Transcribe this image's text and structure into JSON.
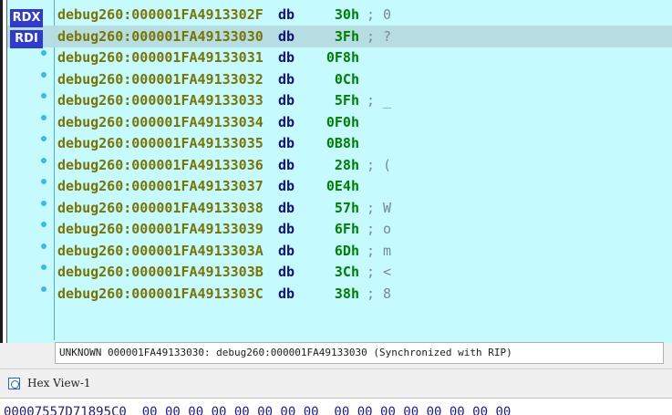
{
  "registers": [
    "RDX",
    "RDI"
  ],
  "listing": [
    {
      "addr": "debug260:000001FA4913302F",
      "mnem": "db",
      "oper": "30h",
      "cmt": "; 0"
    },
    {
      "addr": "debug260:000001FA49133030",
      "mnem": "db",
      "oper": "3Fh",
      "cmt": "; ?"
    },
    {
      "addr": "debug260:000001FA49133031",
      "mnem": "db",
      "oper": "0F8h",
      "cmt": ""
    },
    {
      "addr": "debug260:000001FA49133032",
      "mnem": "db",
      "oper": "0Ch",
      "cmt": ""
    },
    {
      "addr": "debug260:000001FA49133033",
      "mnem": "db",
      "oper": "5Fh",
      "cmt": "; _"
    },
    {
      "addr": "debug260:000001FA49133034",
      "mnem": "db",
      "oper": "0F0h",
      "cmt": ""
    },
    {
      "addr": "debug260:000001FA49133035",
      "mnem": "db",
      "oper": "0B8h",
      "cmt": ""
    },
    {
      "addr": "debug260:000001FA49133036",
      "mnem": "db",
      "oper": "28h",
      "cmt": "; ("
    },
    {
      "addr": "debug260:000001FA49133037",
      "mnem": "db",
      "oper": "0E4h",
      "cmt": ""
    },
    {
      "addr": "debug260:000001FA49133038",
      "mnem": "db",
      "oper": "57h",
      "cmt": "; W"
    },
    {
      "addr": "debug260:000001FA49133039",
      "mnem": "db",
      "oper": "6Fh",
      "cmt": "; o"
    },
    {
      "addr": "debug260:000001FA4913303A",
      "mnem": "db",
      "oper": "6Dh",
      "cmt": "; m"
    },
    {
      "addr": "debug260:000001FA4913303B",
      "mnem": "db",
      "oper": "3Ch",
      "cmt": "; <"
    },
    {
      "addr": "debug260:000001FA4913303C",
      "mnem": "db",
      "oper": "38h",
      "cmt": "; 8"
    }
  ],
  "status_line": "UNKNOWN 000001FA49133030: debug260:000001FA49133030 (Synchronized with RIP)",
  "hexview": {
    "title": "Hex View-1",
    "row_addr": "00007557D71895C0",
    "row_bytes": "00 00 00 00 00 00 00 00  00 00 00 00 00 00 00 00"
  },
  "colors": {
    "listing_bg": "#c5fbff",
    "highlight": "#b5dde2",
    "register_badge": "#2f3bd0",
    "address": "#7a7400",
    "mnemonic": "#101080",
    "operand": "#008000",
    "comment": "#7a8898",
    "breakpoint_dot": "#3db6f0"
  }
}
